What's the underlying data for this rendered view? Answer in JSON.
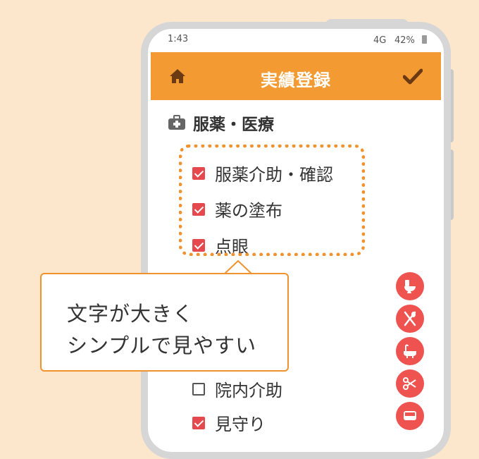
{
  "status_bar": {
    "time": "1:43",
    "network": "4G",
    "battery": "42%"
  },
  "app_bar": {
    "title": "実績登録",
    "left_icon": "home-icon",
    "right_icon": "check-icon"
  },
  "section": {
    "label": "服薬・医療",
    "icon": "medical-kit-icon"
  },
  "items": [
    {
      "label": "服薬介助・確認",
      "checked": true
    },
    {
      "label": "薬の塗布",
      "checked": true
    },
    {
      "label": "点眼",
      "checked": true
    },
    {
      "label": "院内介助",
      "checked": false
    },
    {
      "label": "見守り",
      "checked": true
    }
  ],
  "callout": {
    "line1": "文字が大きく",
    "line2": "シンプルで見やすい"
  },
  "fabs": [
    "toilet-icon",
    "meal-icon",
    "bath-icon",
    "scissors-icon",
    "car-icon"
  ],
  "colors": {
    "accent": "#f39a33",
    "check": "#e5484d",
    "fab": "#ef5350",
    "background": "#fde7cc"
  }
}
